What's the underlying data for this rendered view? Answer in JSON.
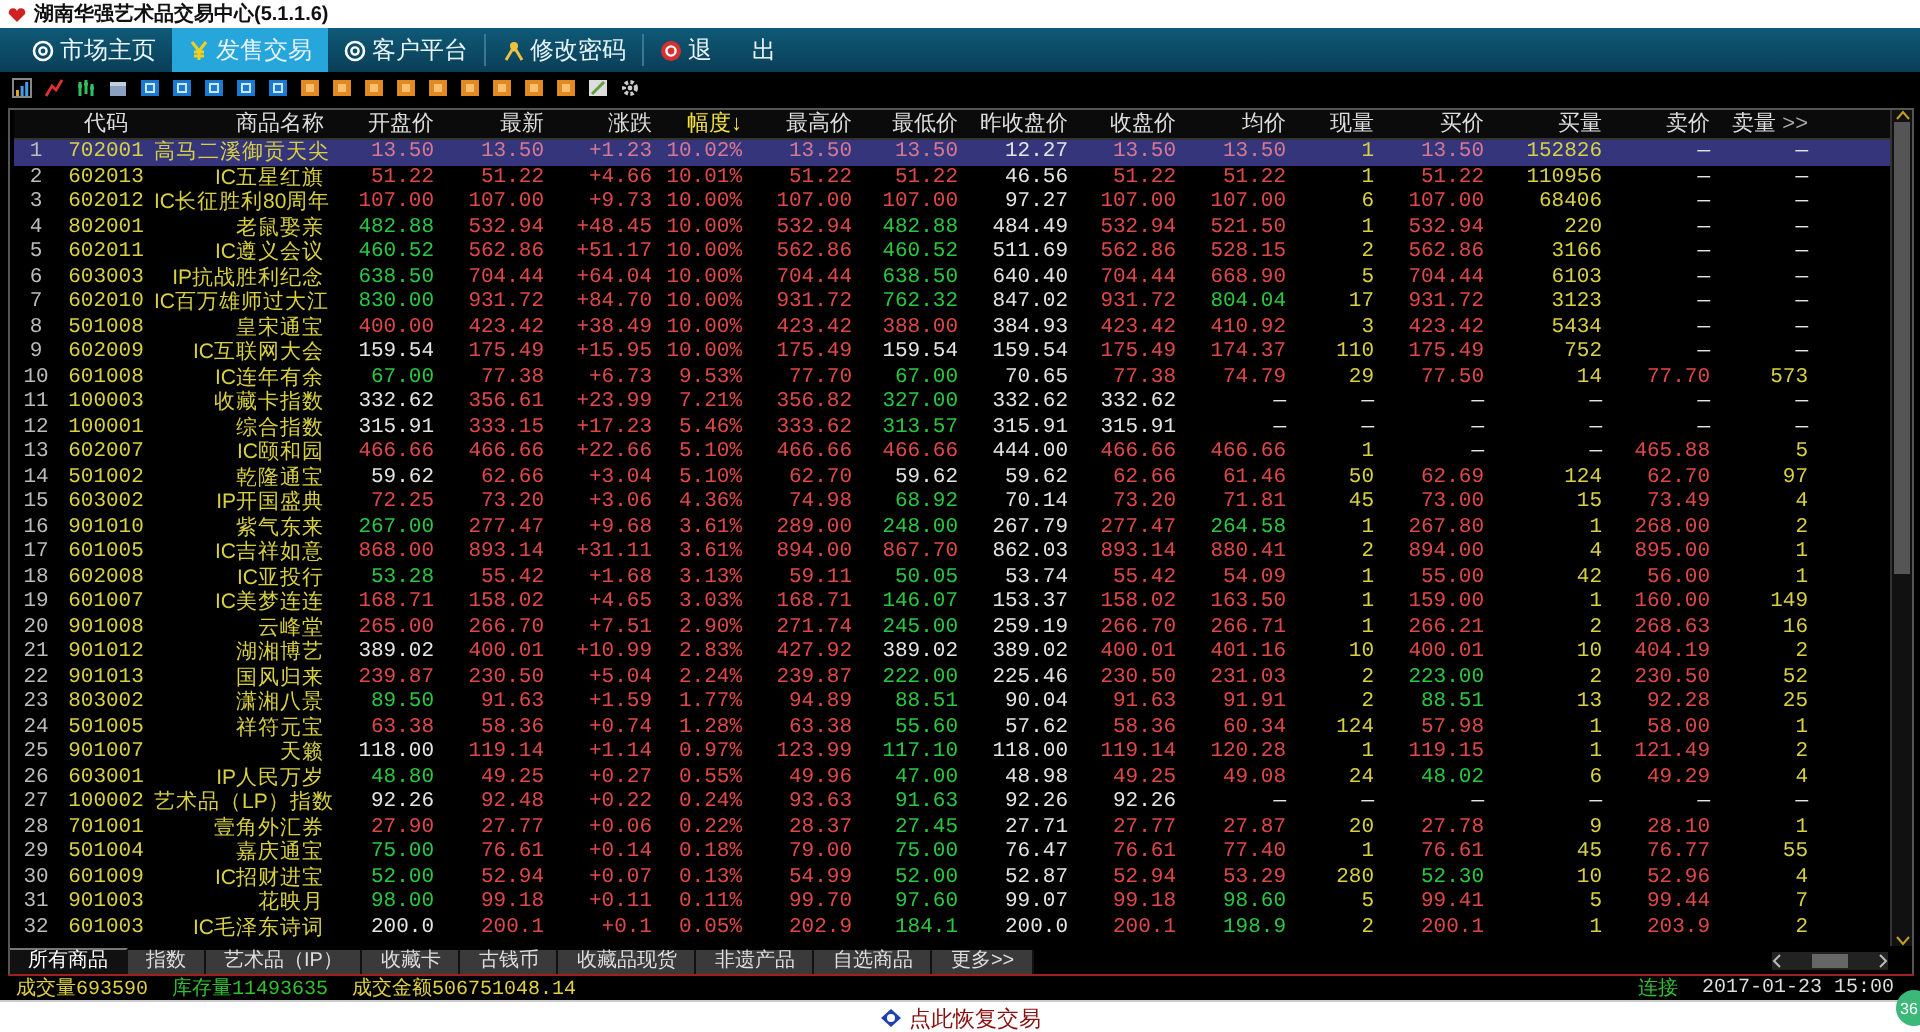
{
  "window": {
    "title": "湖南华强艺术品交易中心(5.1.1.6)"
  },
  "nav": [
    {
      "label": "市场主页",
      "kind": "at",
      "selected": false
    },
    {
      "label": "发售交易",
      "kind": "yen",
      "selected": true
    },
    {
      "label": "客户平台",
      "kind": "at",
      "selected": false
    },
    {
      "label": "修改密码",
      "kind": "person",
      "selected": false
    },
    {
      "label": "退      出",
      "kind": "power",
      "selected": false
    }
  ],
  "table": {
    "columns": [
      {
        "kind": "index"
      },
      {
        "label": "代码",
        "kind": "code"
      },
      {
        "label": "商品名称",
        "kind": "name"
      },
      {
        "label": "开盘价",
        "kind": "price"
      },
      {
        "label": "最新",
        "kind": "price"
      },
      {
        "label": "涨跌",
        "kind": "change"
      },
      {
        "label": "幅度↓",
        "kind": "change",
        "sorted": true
      },
      {
        "label": "最高价",
        "kind": "price"
      },
      {
        "label": "最低价",
        "kind": "price"
      },
      {
        "label": "昨收盘价",
        "kind": "prev"
      },
      {
        "label": "收盘价",
        "kind": "price"
      },
      {
        "label": "均价",
        "kind": "price"
      },
      {
        "label": "现量",
        "kind": "volume"
      },
      {
        "label": "买价",
        "kind": "price"
      },
      {
        "label": "买量",
        "kind": "volume"
      },
      {
        "label": "卖价",
        "kind": "price"
      },
      {
        "label": "卖量",
        "kind": "volume",
        "more": ">>"
      }
    ],
    "rows": [
      {
        "selected": true,
        "cells": [
          "1",
          "702001",
          "高马二溪御贡天尖",
          "13.50",
          "13.50",
          "+1.23",
          "10.02%",
          "13.50",
          "13.50",
          "12.27",
          "13.50",
          "13.50",
          "1",
          "13.50",
          "152826",
          "—",
          "—"
        ]
      },
      {
        "selected": false,
        "cells": [
          "2",
          "602013",
          "IC五星红旗",
          "51.22",
          "51.22",
          "+4.66",
          "10.01%",
          "51.22",
          "51.22",
          "46.56",
          "51.22",
          "51.22",
          "1",
          "51.22",
          "110956",
          "—",
          "—"
        ]
      },
      {
        "selected": false,
        "cells": [
          "3",
          "602012",
          "IC长征胜利80周年",
          "107.00",
          "107.00",
          "+9.73",
          "10.00%",
          "107.00",
          "107.00",
          "97.27",
          "107.00",
          "107.00",
          "6",
          "107.00",
          "68406",
          "—",
          "—"
        ]
      },
      {
        "selected": false,
        "cells": [
          "4",
          "802001",
          "老鼠娶亲",
          "482.88",
          "532.94",
          "+48.45",
          "10.00%",
          "532.94",
          "482.88",
          "484.49",
          "532.94",
          "521.50",
          "1",
          "532.94",
          "220",
          "—",
          "—"
        ]
      },
      {
        "selected": false,
        "cells": [
          "5",
          "602011",
          "IC遵义会议",
          "460.52",
          "562.86",
          "+51.17",
          "10.00%",
          "562.86",
          "460.52",
          "511.69",
          "562.86",
          "528.15",
          "2",
          "562.86",
          "3166",
          "—",
          "—"
        ]
      },
      {
        "selected": false,
        "cells": [
          "6",
          "603003",
          "IP抗战胜利纪念",
          "638.50",
          "704.44",
          "+64.04",
          "10.00%",
          "704.44",
          "638.50",
          "640.40",
          "704.44",
          "668.90",
          "5",
          "704.44",
          "6103",
          "—",
          "—"
        ]
      },
      {
        "selected": false,
        "cells": [
          "7",
          "602010",
          "IC百万雄师过大江",
          "830.00",
          "931.72",
          "+84.70",
          "10.00%",
          "931.72",
          "762.32",
          "847.02",
          "931.72",
          "804.04",
          "17",
          "931.72",
          "3123",
          "—",
          "—"
        ]
      },
      {
        "selected": false,
        "cells": [
          "8",
          "501008",
          "皇宋通宝",
          "400.00",
          "423.42",
          "+38.49",
          "10.00%",
          "423.42",
          "388.00",
          "384.93",
          "423.42",
          "410.92",
          "3",
          "423.42",
          "5434",
          "—",
          "—"
        ]
      },
      {
        "selected": false,
        "cells": [
          "9",
          "602009",
          "IC互联网大会",
          "159.54",
          "175.49",
          "+15.95",
          "10.00%",
          "175.49",
          "159.54",
          "159.54",
          "175.49",
          "174.37",
          "110",
          "175.49",
          "752",
          "—",
          "—"
        ]
      },
      {
        "selected": false,
        "cells": [
          "10",
          "601008",
          "IC连年有余",
          "67.00",
          "77.38",
          "+6.73",
          "9.53%",
          "77.70",
          "67.00",
          "70.65",
          "77.38",
          "74.79",
          "29",
          "77.50",
          "14",
          "77.70",
          "573"
        ]
      },
      {
        "selected": false,
        "cells": [
          "11",
          "100003",
          "收藏卡指数",
          "332.62",
          "356.61",
          "+23.99",
          "7.21%",
          "356.82",
          "327.00",
          "332.62",
          "332.62",
          "—",
          "—",
          "—",
          "—",
          "—",
          "—"
        ]
      },
      {
        "selected": false,
        "cells": [
          "12",
          "100001",
          "综合指数",
          "315.91",
          "333.15",
          "+17.23",
          "5.46%",
          "333.62",
          "313.57",
          "315.91",
          "315.91",
          "—",
          "—",
          "—",
          "—",
          "—",
          "—"
        ]
      },
      {
        "selected": false,
        "cells": [
          "13",
          "602007",
          "IC颐和园",
          "466.66",
          "466.66",
          "+22.66",
          "5.10%",
          "466.66",
          "466.66",
          "444.00",
          "466.66",
          "466.66",
          "1",
          "—",
          "—",
          "465.88",
          "5"
        ]
      },
      {
        "selected": false,
        "cells": [
          "14",
          "501002",
          "乾隆通宝",
          "59.62",
          "62.66",
          "+3.04",
          "5.10%",
          "62.70",
          "59.62",
          "59.62",
          "62.66",
          "61.46",
          "50",
          "62.69",
          "124",
          "62.70",
          "97"
        ]
      },
      {
        "selected": false,
        "cells": [
          "15",
          "603002",
          "IP开国盛典",
          "72.25",
          "73.20",
          "+3.06",
          "4.36%",
          "74.98",
          "68.92",
          "70.14",
          "73.20",
          "71.81",
          "45",
          "73.00",
          "15",
          "73.49",
          "4"
        ]
      },
      {
        "selected": false,
        "cells": [
          "16",
          "901010",
          "紫气东来",
          "267.00",
          "277.47",
          "+9.68",
          "3.61%",
          "289.00",
          "248.00",
          "267.79",
          "277.47",
          "264.58",
          "1",
          "267.80",
          "1",
          "268.00",
          "2"
        ]
      },
      {
        "selected": false,
        "cells": [
          "17",
          "601005",
          "IC吉祥如意",
          "868.00",
          "893.14",
          "+31.11",
          "3.61%",
          "894.00",
          "867.70",
          "862.03",
          "893.14",
          "880.41",
          "2",
          "894.00",
          "4",
          "895.00",
          "1"
        ]
      },
      {
        "selected": false,
        "cells": [
          "18",
          "602008",
          "IC亚投行",
          "53.28",
          "55.42",
          "+1.68",
          "3.13%",
          "59.11",
          "50.05",
          "53.74",
          "55.42",
          "54.09",
          "1",
          "55.00",
          "42",
          "56.00",
          "1"
        ]
      },
      {
        "selected": false,
        "cells": [
          "19",
          "601007",
          "IC美梦连连",
          "168.71",
          "158.02",
          "+4.65",
          "3.03%",
          "168.71",
          "146.07",
          "153.37",
          "158.02",
          "163.50",
          "1",
          "159.00",
          "1",
          "160.00",
          "149"
        ]
      },
      {
        "selected": false,
        "cells": [
          "20",
          "901008",
          "云峰堂",
          "265.00",
          "266.70",
          "+7.51",
          "2.90%",
          "271.74",
          "245.00",
          "259.19",
          "266.70",
          "266.71",
          "1",
          "266.21",
          "2",
          "268.63",
          "16"
        ]
      },
      {
        "selected": false,
        "cells": [
          "21",
          "901012",
          "湖湘博艺",
          "389.02",
          "400.01",
          "+10.99",
          "2.83%",
          "427.92",
          "389.02",
          "389.02",
          "400.01",
          "401.16",
          "10",
          "400.01",
          "10",
          "404.19",
          "2"
        ]
      },
      {
        "selected": false,
        "cells": [
          "22",
          "901013",
          "国风归来",
          "239.87",
          "230.50",
          "+5.04",
          "2.24%",
          "239.87",
          "222.00",
          "225.46",
          "230.50",
          "231.03",
          "2",
          "223.00",
          "2",
          "230.50",
          "52"
        ]
      },
      {
        "selected": false,
        "cells": [
          "23",
          "803002",
          "潇湘八景",
          "89.50",
          "91.63",
          "+1.59",
          "1.77%",
          "94.89",
          "88.51",
          "90.04",
          "91.63",
          "91.91",
          "2",
          "88.51",
          "13",
          "92.28",
          "25"
        ]
      },
      {
        "selected": false,
        "cells": [
          "24",
          "501005",
          "祥符元宝",
          "63.38",
          "58.36",
          "+0.74",
          "1.28%",
          "63.38",
          "55.60",
          "57.62",
          "58.36",
          "60.34",
          "124",
          "57.98",
          "1",
          "58.00",
          "1"
        ]
      },
      {
        "selected": false,
        "cells": [
          "25",
          "901007",
          "天籁",
          "118.00",
          "119.14",
          "+1.14",
          "0.97%",
          "123.99",
          "117.10",
          "118.00",
          "119.14",
          "120.28",
          "1",
          "119.15",
          "1",
          "121.49",
          "2"
        ]
      },
      {
        "selected": false,
        "cells": [
          "26",
          "603001",
          "IP人民万岁",
          "48.80",
          "49.25",
          "+0.27",
          "0.55%",
          "49.96",
          "47.00",
          "48.98",
          "49.25",
          "49.08",
          "24",
          "48.02",
          "6",
          "49.29",
          "4"
        ]
      },
      {
        "selected": false,
        "cells": [
          "27",
          "100002",
          "艺术品（LP）指数",
          "92.26",
          "92.48",
          "+0.22",
          "0.24%",
          "93.63",
          "91.63",
          "92.26",
          "92.26",
          "—",
          "—",
          "—",
          "—",
          "—",
          "—"
        ]
      },
      {
        "selected": false,
        "cells": [
          "28",
          "701001",
          "壹角外汇券",
          "27.90",
          "27.77",
          "+0.06",
          "0.22%",
          "28.37",
          "27.45",
          "27.71",
          "27.77",
          "27.87",
          "20",
          "27.78",
          "9",
          "28.10",
          "1"
        ]
      },
      {
        "selected": false,
        "cells": [
          "29",
          "501004",
          "嘉庆通宝",
          "75.00",
          "76.61",
          "+0.14",
          "0.18%",
          "79.00",
          "75.00",
          "76.47",
          "76.61",
          "77.40",
          "1",
          "76.61",
          "45",
          "76.77",
          "55"
        ]
      },
      {
        "selected": false,
        "cells": [
          "30",
          "601009",
          "IC招财进宝",
          "52.00",
          "52.94",
          "+0.07",
          "0.13%",
          "54.99",
          "52.00",
          "52.87",
          "52.94",
          "53.29",
          "280",
          "52.30",
          "10",
          "52.96",
          "4"
        ]
      },
      {
        "selected": false,
        "cells": [
          "31",
          "901003",
          "花映月",
          "98.00",
          "99.18",
          "+0.11",
          "0.11%",
          "99.70",
          "97.60",
          "99.07",
          "99.18",
          "98.60",
          "5",
          "99.41",
          "5",
          "99.44",
          "7"
        ]
      },
      {
        "selected": false,
        "cells": [
          "32",
          "601003",
          "IC毛泽东诗词",
          "200.0",
          "200.1",
          "+0.1",
          "0.05%",
          "202.9",
          "184.1",
          "200.0",
          "200.1",
          "198.9",
          "2",
          "200.1",
          "1",
          "203.9",
          "2"
        ]
      }
    ]
  },
  "category_tabs": [
    {
      "label": "所有商品",
      "selected": true
    },
    {
      "label": "指数",
      "selected": false
    },
    {
      "label": "艺术品（IP）",
      "selected": false
    },
    {
      "label": "收藏卡",
      "selected": false
    },
    {
      "label": "古钱币",
      "selected": false
    },
    {
      "label": "收藏品现货",
      "selected": false
    },
    {
      "label": "非遗产品",
      "selected": false
    },
    {
      "label": "自选商品",
      "selected": false
    },
    {
      "label": "更多>>",
      "selected": false
    }
  ],
  "status_bar": {
    "left": [
      {
        "text": "成交量693590",
        "kind": "volume"
      },
      {
        "text": "库存量11493635",
        "kind": "stock"
      },
      {
        "text": "成交金额506751048.14",
        "kind": "amount"
      }
    ],
    "connection": "连接",
    "time": "2017-01-23 15:00"
  },
  "restore": {
    "label": "点此恢复交易"
  },
  "badge": "36"
}
